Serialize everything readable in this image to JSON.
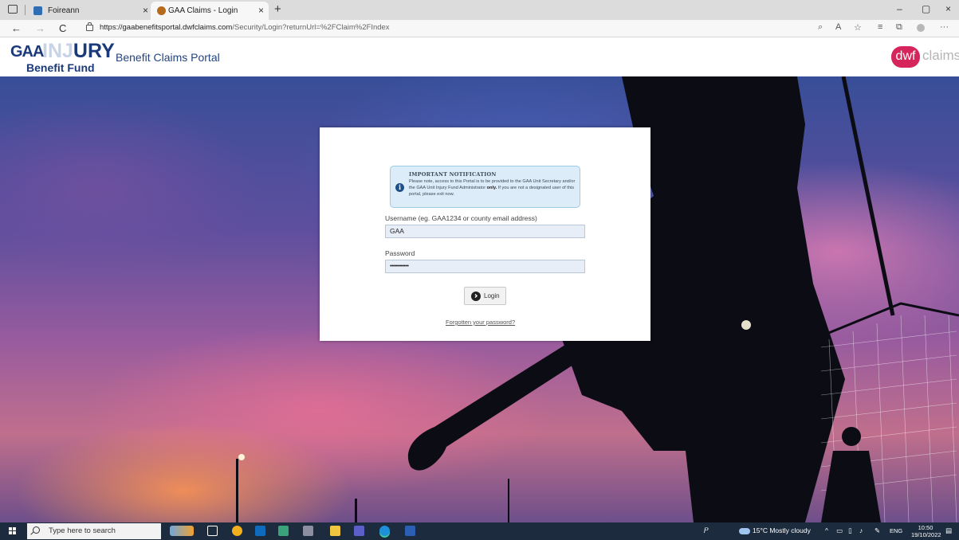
{
  "browser": {
    "tabs": [
      {
        "label": "Foireann",
        "close": "×"
      },
      {
        "label": "GAA Claims - Login",
        "close": "×"
      }
    ],
    "new_tab": "+",
    "window_controls": {
      "minimize": "–",
      "restore": "▢",
      "close": "×"
    },
    "nav": {
      "back": "←",
      "forward": "→",
      "refresh": "C"
    },
    "url_host": "https://gaabenefitsportal.dwfclaims.com",
    "url_path": "/Security/Login?returnUrl=%2FClaim%2FIndex",
    "toolbar_icons": [
      "zoom-icon",
      "read-aloud-icon",
      "favorite-add-icon",
      "favorites-icon",
      "collections-icon",
      "profile-icon",
      "more-icon"
    ],
    "more": "···"
  },
  "header": {
    "logo_gaa": "GAA",
    "logo_injury_a": "INJ",
    "logo_injury_b": "URY",
    "logo_fund": "Benefit Fund",
    "portal_title": "Benefit Claims Portal",
    "dwf_badge": "dwf",
    "dwf_claims": "claims"
  },
  "login": {
    "notice_title": "IMPORTANT NOTIFICATION",
    "notice_body_1": "Please note, access to this Portal is to be provided to the GAA Unit Secretary and/or the GAA Unit Injury Fund Administrator",
    "notice_body_bold": "only.",
    "notice_body_2": "If you are not a designated user of this portal, please exit now.",
    "notice_icon": "i",
    "username_label": "Username (eg. GAA1234 or county email address)",
    "username_value": "GAA",
    "password_label": "Password",
    "password_value": "••••••••••••",
    "login_button": "Login",
    "forgot_link": "Forgotten your password?"
  },
  "taskbar": {
    "search_placeholder": "Type here to search",
    "weather": "15°C  Mostly cloudy",
    "language": "ENG",
    "time": "10:50",
    "date": "19/10/2022",
    "colors": {
      "edge": "#1e8fd8",
      "outlook": "#0f6cbd",
      "word": "#2b5fb4",
      "teams": "#5b5fc7",
      "chrome": "#f2b01e",
      "explorer": "#f0c540"
    }
  }
}
